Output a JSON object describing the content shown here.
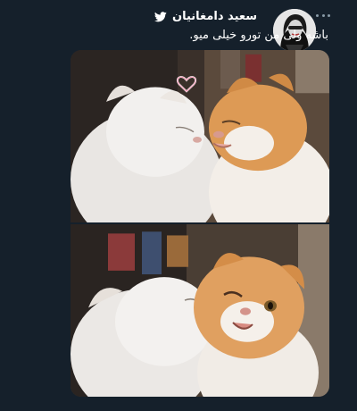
{
  "tweet": {
    "author_name": "سعید دامغانیان",
    "text": "باشه ولی من تورو خیلی میو.",
    "icons": {
      "platform": "twitter-bird-icon",
      "menu": "more-options-icon"
    },
    "colors": {
      "background": "#15202b",
      "primary_text": "#ffffff",
      "secondary_text": "#8899a6",
      "brand": "#ffffff"
    },
    "media": {
      "count": 2
    }
  }
}
